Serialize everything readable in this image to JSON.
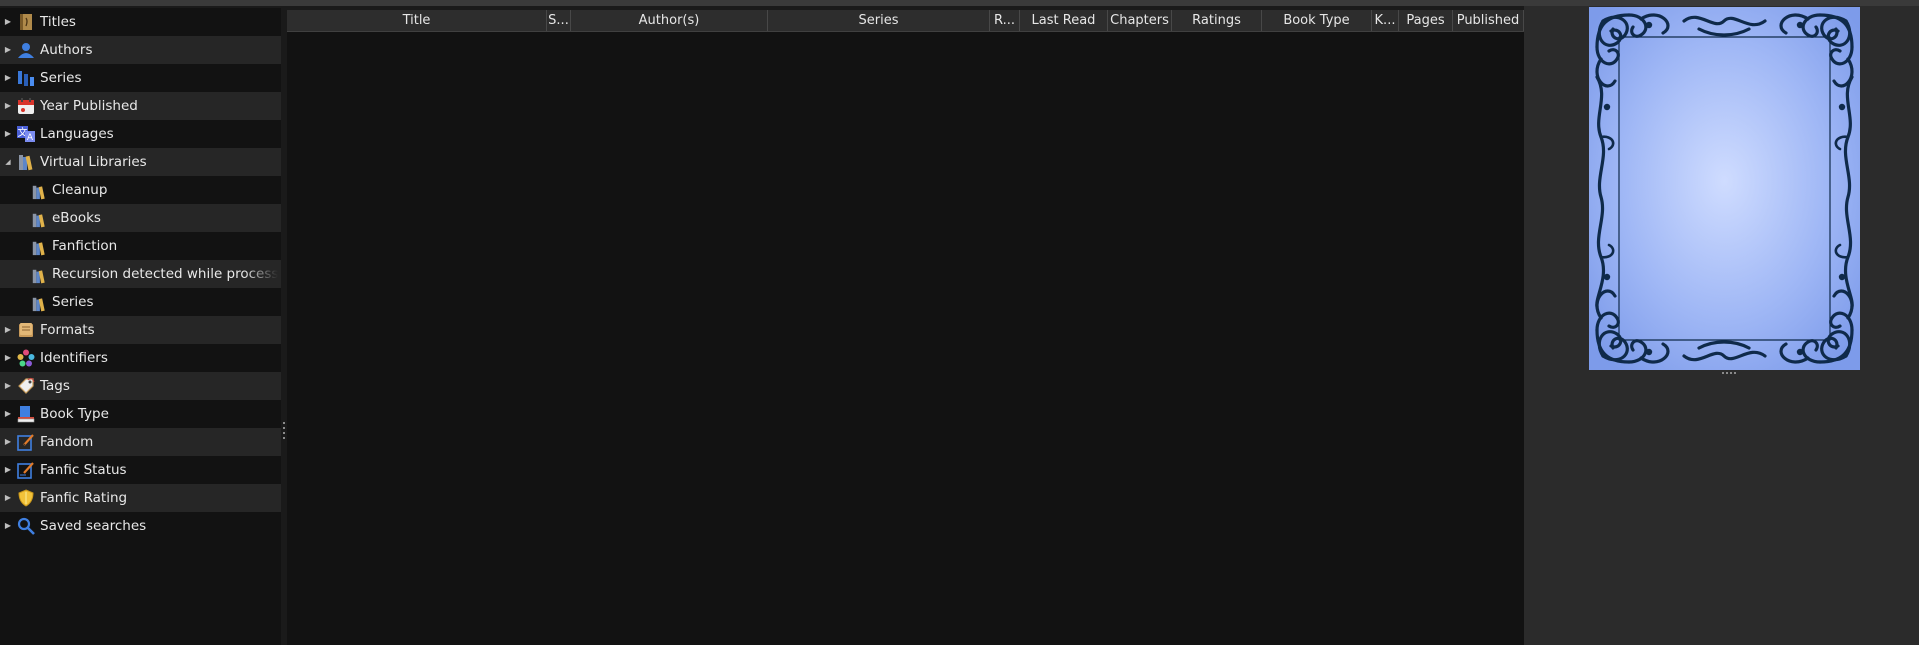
{
  "tag_browser": {
    "items": [
      {
        "label": "Titles",
        "icon": "titles-icon",
        "expanded": false
      },
      {
        "label": "Authors",
        "icon": "authors-icon",
        "expanded": false
      },
      {
        "label": "Series",
        "icon": "series-icon",
        "expanded": false
      },
      {
        "label": "Year Published",
        "icon": "calendar-icon",
        "expanded": false
      },
      {
        "label": "Languages",
        "icon": "languages-icon",
        "expanded": false
      },
      {
        "label": "Virtual Libraries",
        "icon": "virtual-library-icon",
        "expanded": true,
        "children": [
          {
            "label": "Cleanup",
            "icon": "virtual-library-icon"
          },
          {
            "label": "eBooks",
            "icon": "virtual-library-icon"
          },
          {
            "label": "Fanfiction",
            "icon": "virtual-library-icon"
          },
          {
            "label": "Recursion detected while processing",
            "icon": "virtual-library-icon"
          },
          {
            "label": "Series",
            "icon": "virtual-library-icon"
          }
        ]
      },
      {
        "label": "Formats",
        "icon": "formats-icon",
        "expanded": false
      },
      {
        "label": "Identifiers",
        "icon": "identifiers-icon",
        "expanded": false
      },
      {
        "label": "Tags",
        "icon": "tags-icon",
        "expanded": false
      },
      {
        "label": "Book Type",
        "icon": "book-type-icon",
        "expanded": false
      },
      {
        "label": "Fandom",
        "icon": "fandom-icon",
        "expanded": false
      },
      {
        "label": "Fanfic Status",
        "icon": "fanfic-status-icon",
        "expanded": false
      },
      {
        "label": "Fanfic Rating",
        "icon": "shield-icon",
        "expanded": false
      },
      {
        "label": "Saved searches",
        "icon": "search-icon",
        "expanded": false
      }
    ]
  },
  "book_list": {
    "columns": [
      "Title",
      "S...",
      "Author(s)",
      "Series",
      "R...",
      "Last Read",
      "Chapters",
      "Ratings",
      "Book Type",
      "K...",
      "Pages",
      "Published"
    ]
  },
  "colors": {
    "cover_light": "#cfdcff",
    "cover_mid": "#9eb6f5",
    "cover_edge": "#7d9bea",
    "ornament": "#0f2a4a"
  }
}
